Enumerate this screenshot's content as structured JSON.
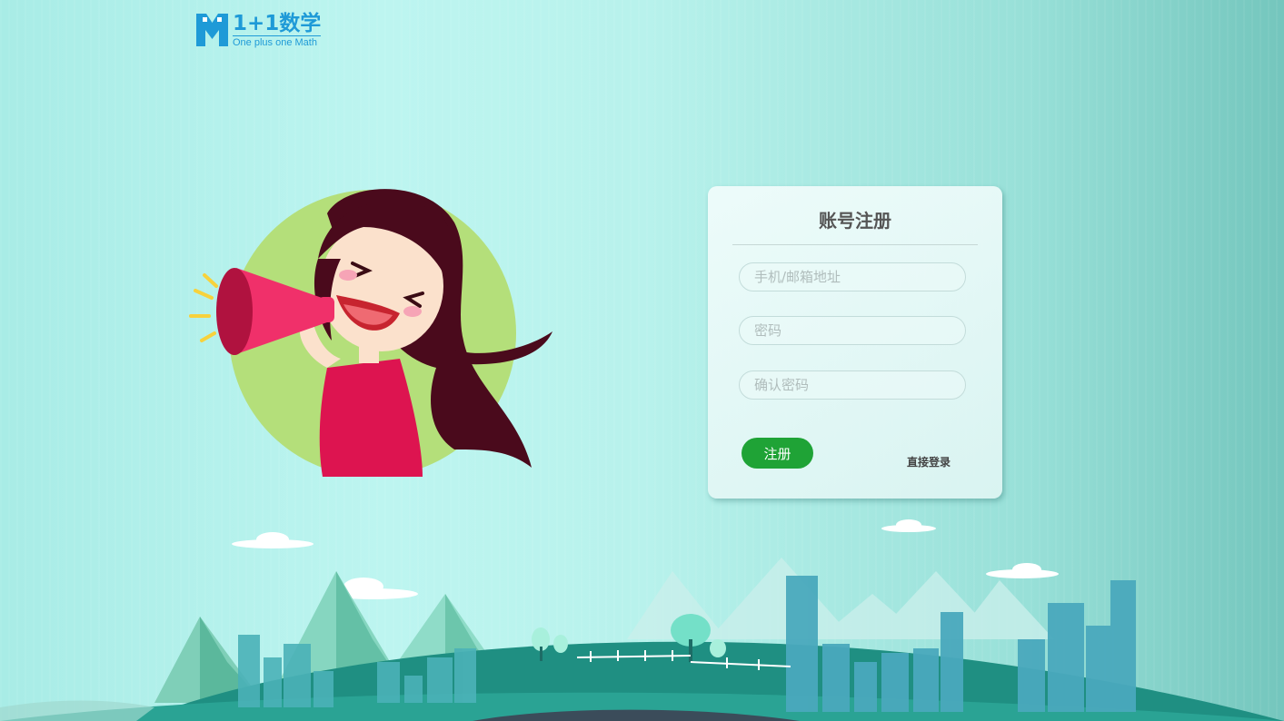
{
  "logo": {
    "title": "1+1数学",
    "subtitle": "One plus one Math"
  },
  "form": {
    "title": "账号注册",
    "account_placeholder": "手机/邮箱地址",
    "password_placeholder": "密码",
    "confirm_placeholder": "确认密码",
    "register_label": "注册",
    "login_link": "直接登录"
  },
  "colors": {
    "brand": "#1e9ad7",
    "register_button": "#1fa336",
    "text_dark": "#555555"
  }
}
